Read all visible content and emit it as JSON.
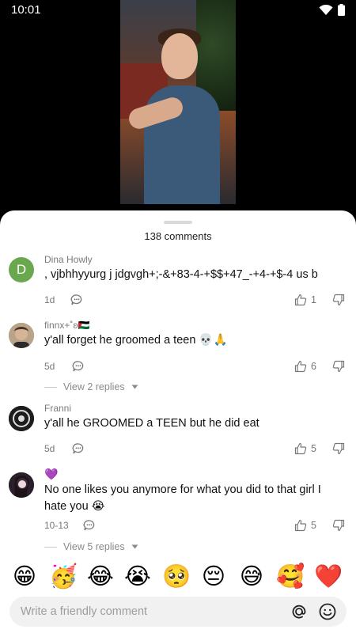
{
  "status_bar": {
    "time": "10:01",
    "icons": [
      "wifi-icon",
      "battery-icon"
    ]
  },
  "video": {
    "content": "video-player"
  },
  "sheet": {
    "count_label": "138 comments"
  },
  "comments": [
    {
      "avatar_letter": "D",
      "avatar_color": "#6aa84f",
      "username": "Dina Howly",
      "text": ", vjbhhyyurg j jdgvgh+;-&+83-4-+$$+47_-+4-+$-4 us b",
      "time": "1d",
      "likes": "1"
    },
    {
      "username": "finnx+˚ʚ🇵🇸",
      "text": "y'all forget he groomed a teen 💀🙏",
      "time": "5d",
      "likes": "6",
      "replies_label": "View 2 replies"
    },
    {
      "username": "Franni",
      "text": "y'all he GROOMED a TEEN but he did eat",
      "time": "5d",
      "likes": "5"
    },
    {
      "username": "💜",
      "text": "No one likes you anymore for what you did to that girl I hate you 😭",
      "time": "10-13",
      "likes": "5",
      "replies_label": "View 5 replies"
    }
  ],
  "emoji_bar": [
    "😁",
    "🥳",
    "😂",
    "😭",
    "🥺",
    "😔",
    "😅",
    "🥰",
    "❤️"
  ],
  "input": {
    "placeholder": "Write a friendly comment"
  },
  "colors": {
    "accent_avatar": "#6aa84f",
    "input_bg": "#f1f1f1"
  }
}
